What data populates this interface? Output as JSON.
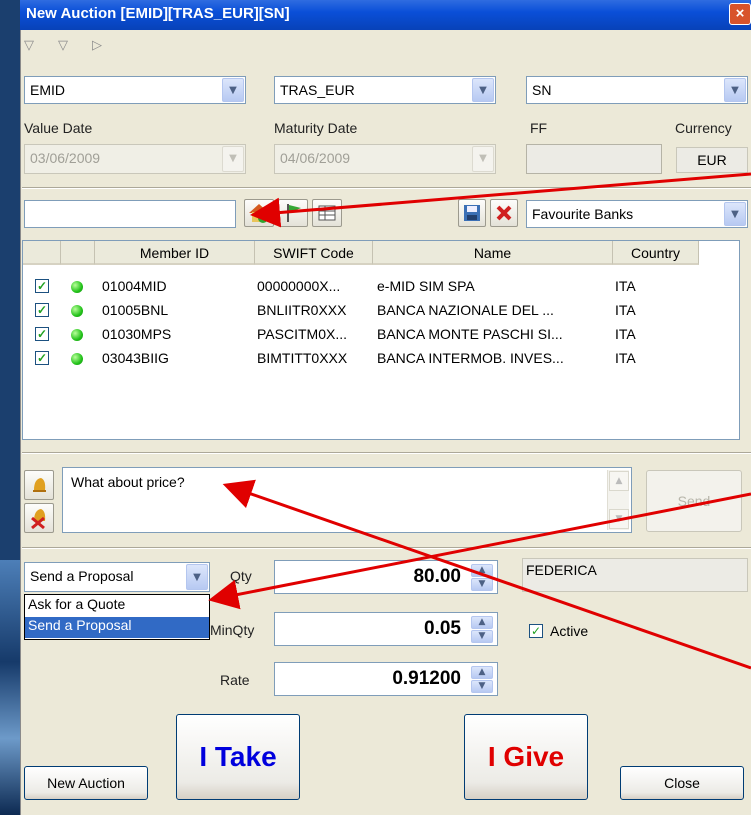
{
  "window": {
    "title": "New Auction [EMID][TRAS_EUR][SN]",
    "close_glyph": "×"
  },
  "nav_glyphs": [
    "▽",
    "▽",
    "▷"
  ],
  "selectors": {
    "market": "EMID",
    "instrument": "TRAS_EUR",
    "tenor": "SN"
  },
  "labels": {
    "value_date": "Value Date",
    "maturity_date": "Maturity Date",
    "ff": "FF",
    "currency": "Currency"
  },
  "dates": {
    "value_date": "03/06/2009",
    "maturity_date": "04/06/2009",
    "ff": "",
    "currency": "EUR"
  },
  "bank_search": {
    "value": "",
    "list": "Favourite Banks"
  },
  "grid": {
    "columns": [
      "Member ID",
      "SWIFT Code",
      "Name",
      "Country"
    ],
    "rows": [
      {
        "member_id": "01004MID",
        "swift": "00000000X...",
        "name": "e-MID SIM SPA",
        "country": "ITA"
      },
      {
        "member_id": "01005BNL",
        "swift": "BNLIITR0XXX",
        "name": "BANCA NAZIONALE DEL ...",
        "country": "ITA"
      },
      {
        "member_id": "01030MPS",
        "swift": "PASCITM0X...",
        "name": "BANCA MONTE PASCHI SI...",
        "country": "ITA"
      },
      {
        "member_id": "03043BIIG",
        "swift": "BIMTITT0XXX",
        "name": "BANCA INTERMOB. INVES...",
        "country": "ITA"
      }
    ]
  },
  "chat": {
    "message": "What about price?",
    "send": "Send"
  },
  "order": {
    "mode": "Send a Proposal",
    "mode_options": [
      "Ask for a Quote",
      "Send a Proposal"
    ],
    "qty_label": "Qty",
    "qty": "80.00",
    "minqty_label": "MinQty",
    "minqty": "0.05",
    "rate_label": "Rate",
    "rate": "0.91200",
    "trader": "FEDERICA",
    "active_label": "Active"
  },
  "buttons": {
    "take": "I Take",
    "give": "I Give",
    "new_auction": "New Auction",
    "close": "Close"
  },
  "colors": {
    "take": "#0000dd",
    "give": "#e00000",
    "titlebar": "#0a4fd8",
    "annotation_arrows": "#e00000"
  }
}
